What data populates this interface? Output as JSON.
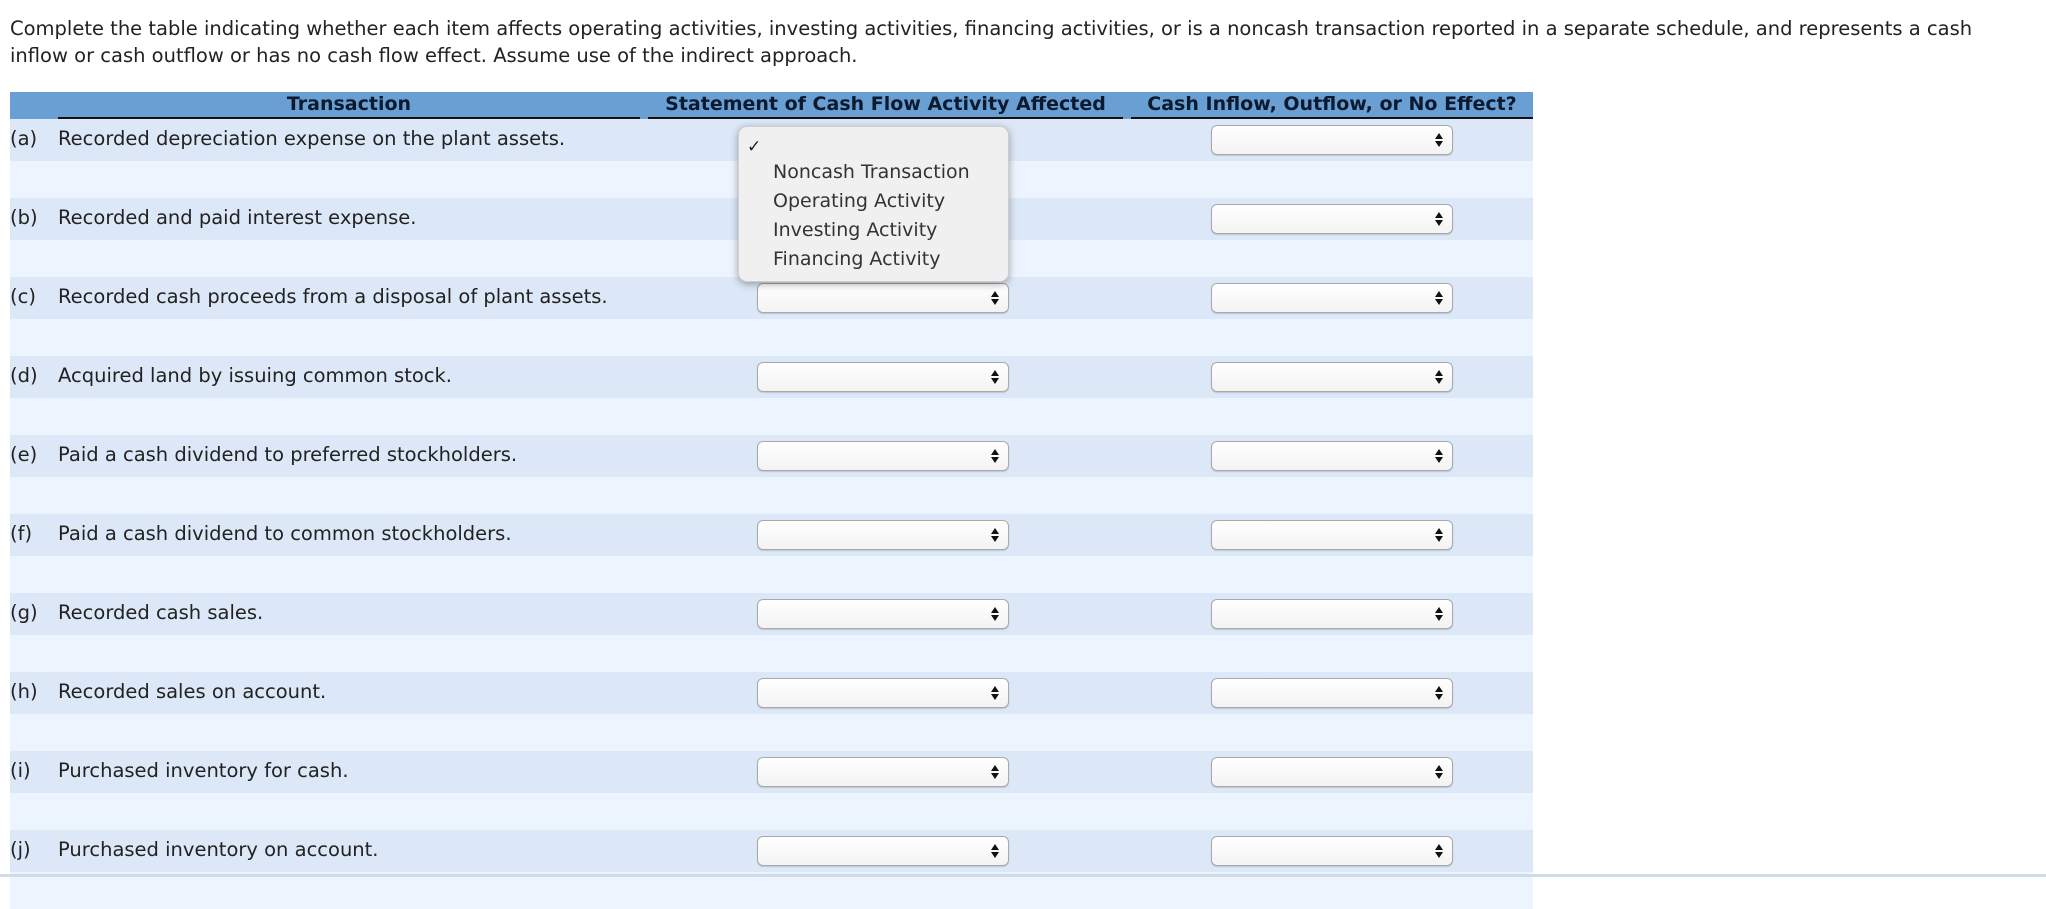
{
  "instructions": "Complete the table indicating whether each item affects operating activities, investing activities, financing activities, or is a noncash transaction reported in a separate schedule, and represents a cash inflow or cash outflow or has no cash flow effect. Assume use of the indirect approach.",
  "table": {
    "headers": [
      "Transaction",
      "Statement of Cash Flow Activity Affected",
      "Cash Inflow, Outflow, or No Effect?"
    ],
    "rows": [
      {
        "label": "(a)",
        "text": "Recorded depreciation expense on the plant assets.",
        "activity": "",
        "effect": ""
      },
      {
        "label": "(b)",
        "text": "Recorded and paid interest expense.",
        "activity": "",
        "effect": ""
      },
      {
        "label": "(c)",
        "text": "Recorded cash proceeds from a disposal of plant assets.",
        "activity": "",
        "effect": ""
      },
      {
        "label": "(d)",
        "text": "Acquired land by issuing common stock.",
        "activity": "",
        "effect": ""
      },
      {
        "label": "(e)",
        "text": "Paid a cash dividend to preferred stockholders.",
        "activity": "",
        "effect": ""
      },
      {
        "label": "(f)",
        "text": "Paid a cash dividend to common stockholders.",
        "activity": "",
        "effect": ""
      },
      {
        "label": "(g)",
        "text": "Recorded cash sales.",
        "activity": "",
        "effect": ""
      },
      {
        "label": "(h)",
        "text": "Recorded sales on account.",
        "activity": "",
        "effect": ""
      },
      {
        "label": "(i)",
        "text": "Purchased inventory for cash.",
        "activity": "",
        "effect": ""
      },
      {
        "label": "(j)",
        "text": "Purchased inventory on account.",
        "activity": "",
        "effect": ""
      }
    ]
  },
  "dropdown_open": {
    "row": "(a)",
    "selected_checkmark": "✓",
    "options": [
      "",
      "Noncash Transaction",
      "Operating Activity",
      "Investing Activity",
      "Financing Activity"
    ]
  },
  "icons": {
    "select_arrows": "up-down-arrows-icon",
    "check": "checkmark-icon"
  },
  "colors": {
    "header_bg": "#6a9fd3",
    "row_band": "#dce8f8",
    "row_spacer": "#ecf4fd",
    "popup_bg": "#f0f0f0"
  }
}
